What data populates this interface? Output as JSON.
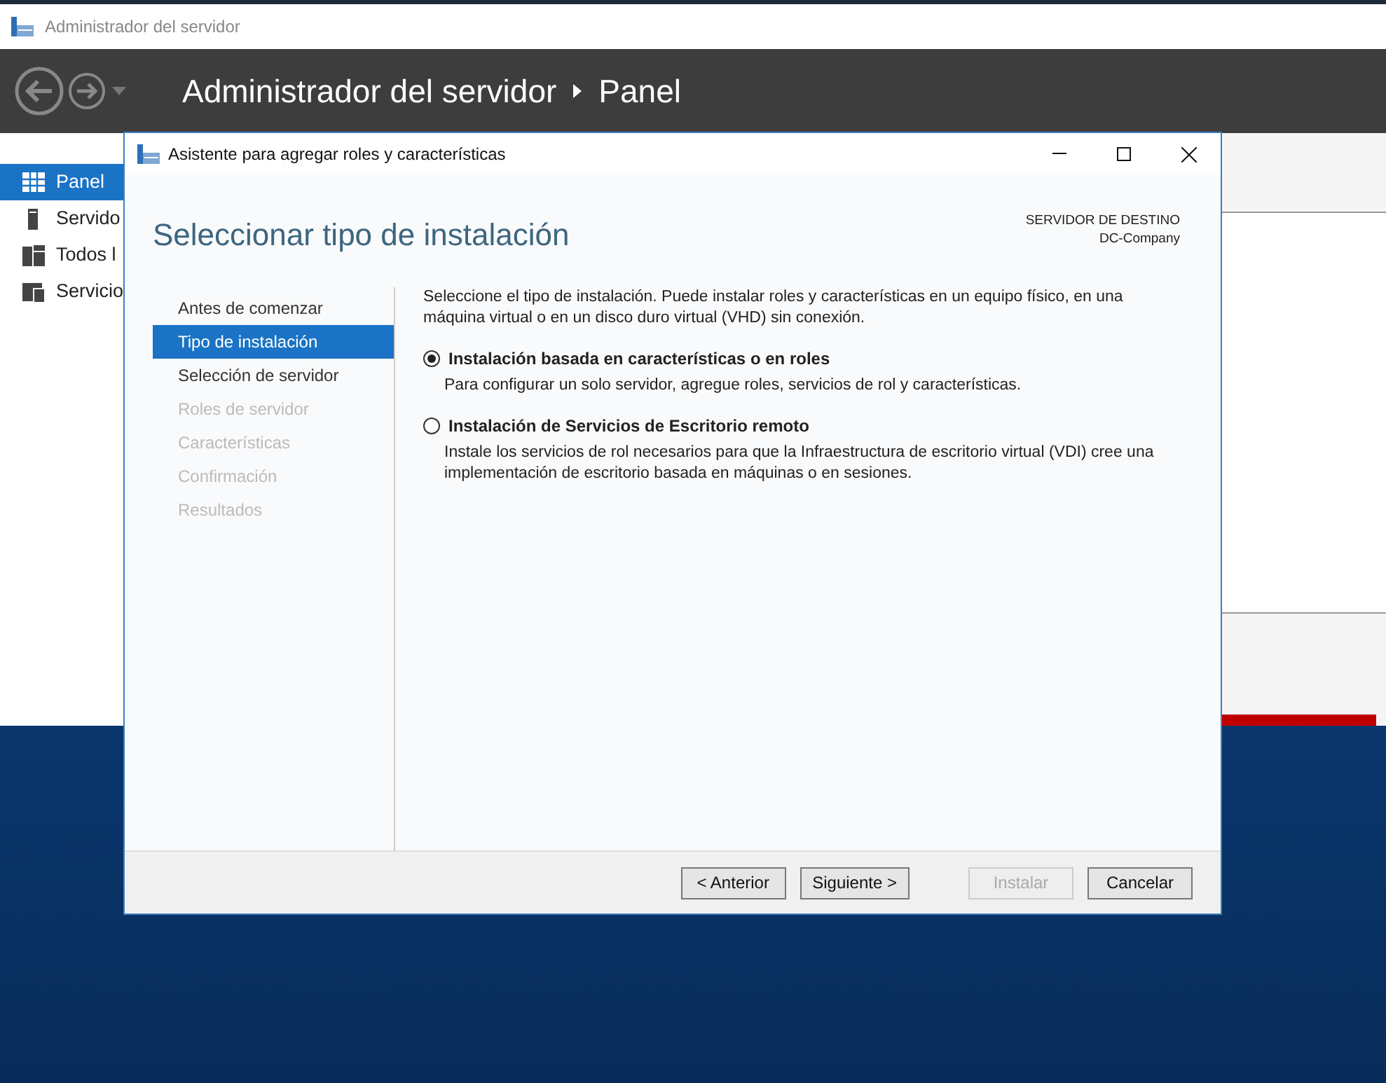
{
  "app_window": {
    "title": "Administrador del servidor",
    "breadcrumb": [
      "Administrador del servidor",
      "Panel"
    ]
  },
  "sidebar": {
    "items": [
      {
        "label": "Panel",
        "kind": "grid",
        "selected": true
      },
      {
        "label": "Servido",
        "kind": "server",
        "selected": false
      },
      {
        "label": "Todos l",
        "kind": "servers",
        "selected": false
      },
      {
        "label": "Servicio",
        "kind": "folder",
        "selected": false
      }
    ]
  },
  "dialog": {
    "title": "Asistente para agregar roles y características",
    "heading": "Seleccionar tipo de instalación",
    "target_label": "SERVIDOR DE DESTINO",
    "target_value": "DC-Company",
    "steps": [
      {
        "label": "Antes de comenzar",
        "selected": false,
        "disabled": false
      },
      {
        "label": "Tipo de instalación",
        "selected": true,
        "disabled": false
      },
      {
        "label": "Selección de servidor",
        "selected": false,
        "disabled": false
      },
      {
        "label": "Roles de servidor",
        "selected": false,
        "disabled": true
      },
      {
        "label": "Características",
        "selected": false,
        "disabled": true
      },
      {
        "label": "Confirmación",
        "selected": false,
        "disabled": true
      },
      {
        "label": "Resultados",
        "selected": false,
        "disabled": true
      }
    ],
    "intro": "Seleccione el tipo de instalación. Puede instalar roles y características en un equipo físico, en una máquina virtual o en un disco duro virtual (VHD) sin conexión.",
    "options": [
      {
        "label": "Instalación basada en características o en roles",
        "description": "Para configurar un solo servidor, agregue roles, servicios de rol y características.",
        "selected": true
      },
      {
        "label": "Instalación de Servicios de Escritorio remoto",
        "description": "Instale los servicios de rol necesarios para que la Infraestructura de escritorio virtual (VDI) cree una implementación de escritorio basada en máquinas o en sesiones.",
        "selected": false
      }
    ],
    "buttons": [
      {
        "label": "< Anterior",
        "disabled": false
      },
      {
        "label": "Siguiente >",
        "disabled": false
      },
      {
        "label": "Instalar",
        "disabled": true
      },
      {
        "label": "Cancelar",
        "disabled": false
      }
    ]
  }
}
